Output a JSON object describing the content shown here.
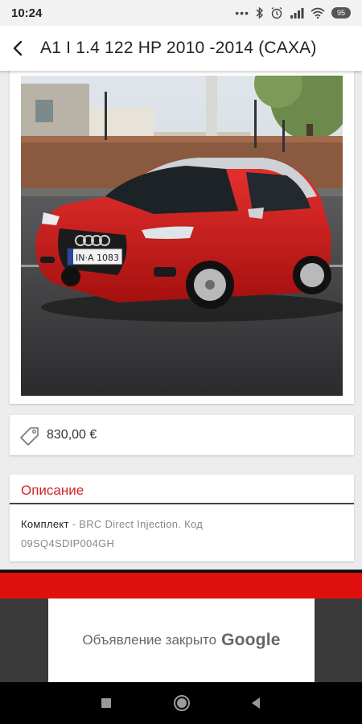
{
  "status_bar": {
    "time": "10:24",
    "dots": "•••",
    "battery": "95"
  },
  "app_bar": {
    "title": "A1 I 1.4 122 HP 2010 -2014 (CAXA)"
  },
  "listing": {
    "price": "830,00 €"
  },
  "description": {
    "heading": "Описание",
    "key": "Комплект",
    "text": " - BRC Direct Injection. Код 09SQ4SDIP004GH"
  },
  "ad": {
    "closed_text": "Объявление закрыто",
    "brand": "Google",
    "red_color": "#e01010"
  },
  "colors": {
    "accent": "#d0242b",
    "car": "#d41a1f"
  }
}
